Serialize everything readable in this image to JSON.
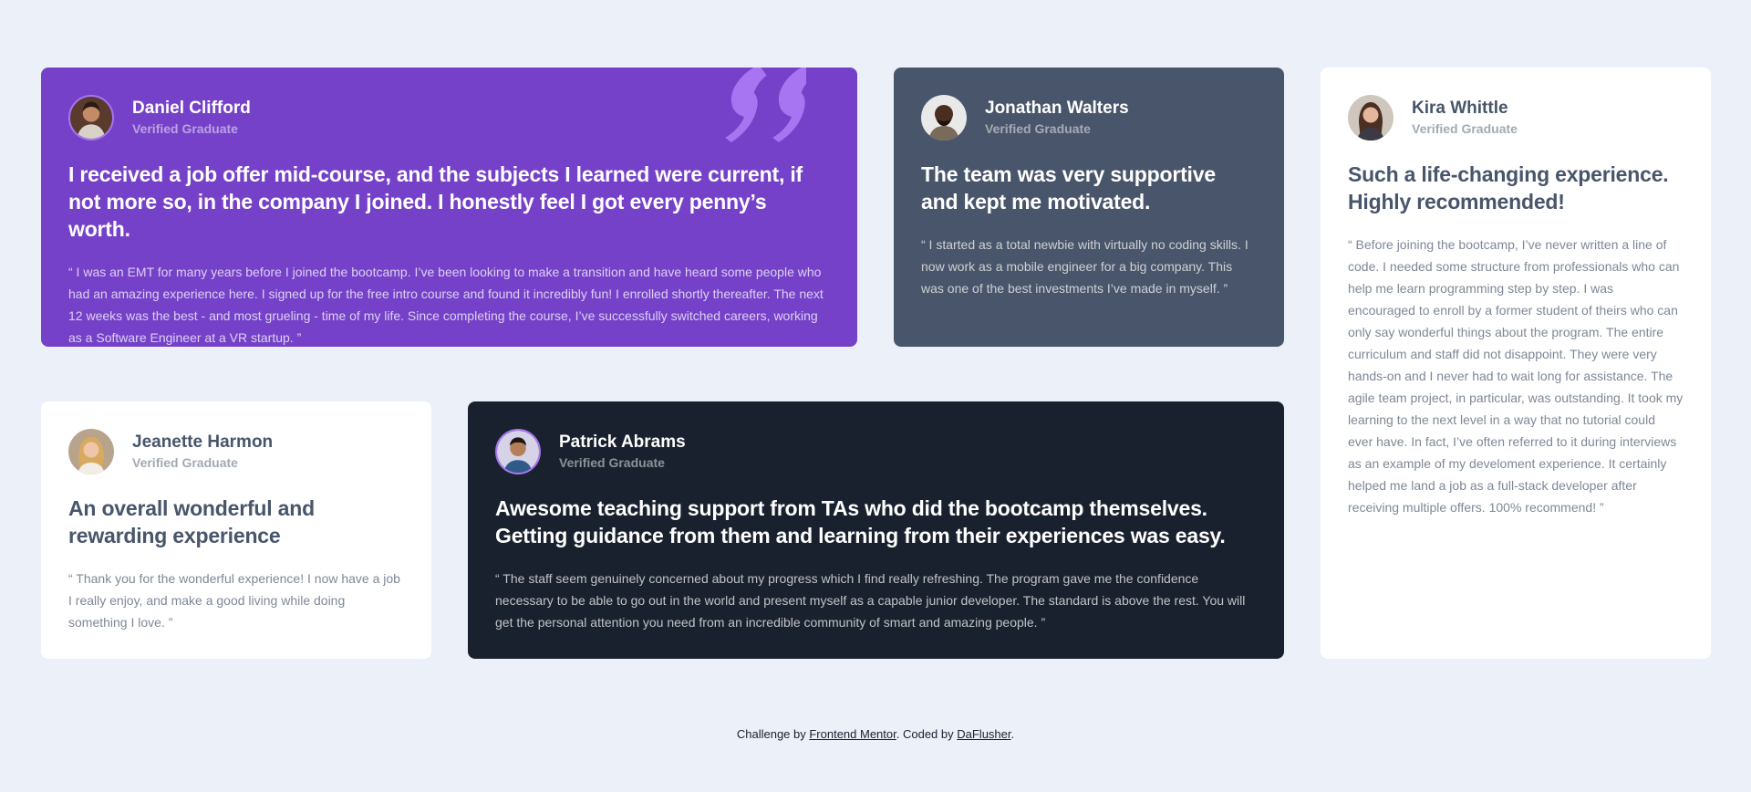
{
  "colors": {
    "background": "#ecf1f9",
    "purple": "#7541c8",
    "grey_blue": "#48556a",
    "white": "#ffffff",
    "dark": "#19212e",
    "quote_mark": "#a775f1"
  },
  "testimonials": [
    {
      "name": "Daniel Clifford",
      "role": "Verified Graduate",
      "headline": "I received a job offer mid-course, and the subjects I learned were current, if not more so, in the company I joined. I honestly feel I got every penny’s worth.",
      "body": "“ I was an EMT for many years before I joined the bootcamp. I’ve been looking to make a transition and have heard some people who had an amazing experience here. I signed up for the free intro course and found it incredibly fun! I enrolled shortly thereafter. The next 12 weeks was the best - and most grueling - time of my life. Since completing the course, I’ve successfully switched careers, working as a Software Engineer at a VR startup. ”",
      "theme": "purple",
      "avatar_icon": "avatar-daniel-icon",
      "decoration_icon": "quotation-mark-icon"
    },
    {
      "name": "Jonathan Walters",
      "role": "Verified Graduate",
      "headline": "The team was very supportive and kept me motivated.",
      "body": "“ I started as a total newbie with virtually no coding skills. I now work as a mobile engineer for a big company. This was one of the best investments I’ve made in myself. ”",
      "theme": "grey",
      "avatar_icon": "avatar-jonathan-icon"
    },
    {
      "name": "Kira Whittle",
      "role": "Verified Graduate",
      "headline": "Such a life-changing experience. Highly recommended!",
      "body": "“ Before joining the bootcamp, I’ve never written a line of code. I needed some structure from professionals who can help me learn programming step by step. I was encouraged to enroll by a former student of theirs who can only say wonderful things about the program. The entire curriculum and staff did not disappoint. They were very hands-on and I never had to wait long for assistance. The agile team project, in particular, was outstanding. It took my learning to the next level in a way that no tutorial could ever have. In fact, I’ve often referred to it during interviews as an example of my develoment experience. It certainly helped me land a job as a full-stack developer after receiving multiple offers. 100% recommend! ”",
      "theme": "white",
      "avatar_icon": "avatar-kira-icon"
    },
    {
      "name": "Jeanette Harmon",
      "role": "Verified Graduate",
      "headline": "An overall wonderful and rewarding experience",
      "body": "“ Thank you for the wonderful experience! I now have a job I really enjoy, and make a good living while doing something I love. ”",
      "theme": "white",
      "avatar_icon": "avatar-jeanette-icon"
    },
    {
      "name": "Patrick Abrams",
      "role": "Verified Graduate",
      "headline": "Awesome teaching support from TAs who did the bootcamp themselves. Getting guidance from them and learning from their experiences was easy.",
      "body": "“ The staff seem genuinely concerned about my progress which I find really refreshing. The program gave me the confidence necessary to be able to go out in the world and present myself as a capable junior developer. The standard is above the rest. You will get the personal attention you need from an incredible community of smart and amazing people. ”",
      "theme": "dark",
      "avatar_icon": "avatar-patrick-icon"
    }
  ],
  "footer": {
    "prefix": "Challenge by ",
    "challenge_link": "Frontend Mentor",
    "middle": ". Coded by ",
    "author_link": "DaFlusher",
    "suffix": "."
  }
}
